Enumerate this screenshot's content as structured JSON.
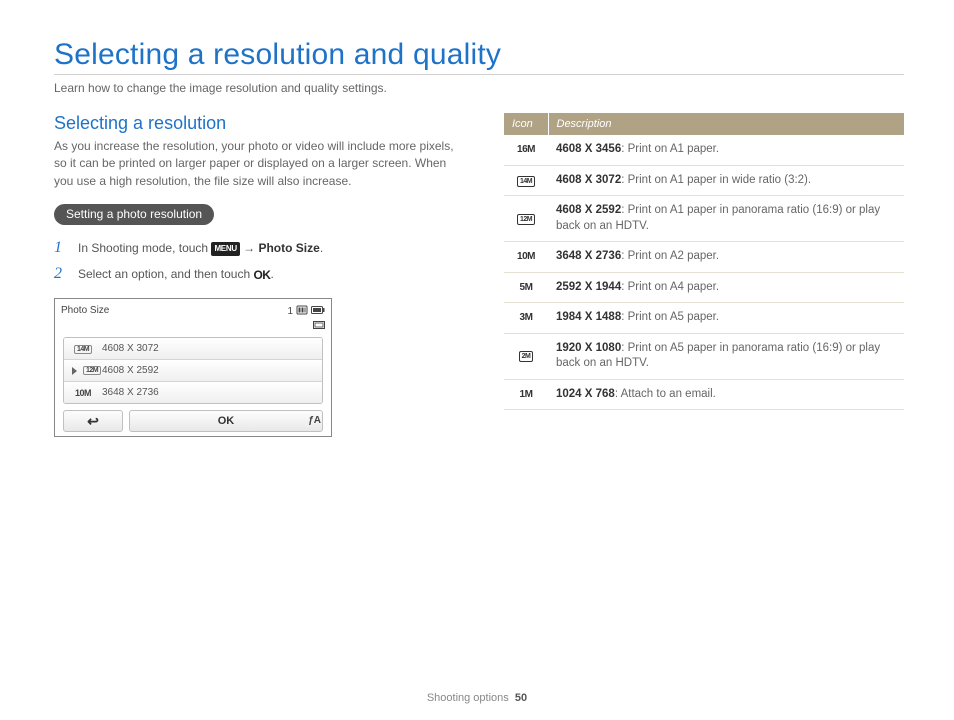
{
  "page": {
    "title": "Selecting a resolution and quality",
    "subtitle": "Learn how to change the image resolution and quality settings."
  },
  "section": {
    "heading": "Selecting a resolution",
    "para": "As you increase the resolution, your photo or video will include more pixels, so it can be printed on larger paper or displayed on a larger screen. When you use a high resolution, the file size will also increase.",
    "pill": "Setting a photo resolution"
  },
  "steps": [
    {
      "num": "1",
      "pre": "In Shooting mode, touch ",
      "menu_chip": "MENU",
      "arrow": " → ",
      "bold": "Photo Size",
      "post": "."
    },
    {
      "num": "2",
      "pre": "Select an option, and then touch ",
      "ok_chip": "OK",
      "post": "."
    }
  ],
  "screen": {
    "title": "Photo Size",
    "status_count": "1",
    "rows": [
      {
        "icon_label": "14M",
        "icon_style": "box",
        "text": "4608 X 3072"
      },
      {
        "icon_label": "12M",
        "icon_style": "box",
        "text": "4608 X 2592",
        "selected": true
      },
      {
        "icon_label": "10M",
        "icon_style": "text",
        "text": "3648 X 2736"
      }
    ],
    "back_glyph": "↩",
    "ok_label": "OK",
    "flash_label": "ƒA"
  },
  "table": {
    "head_icon": "Icon",
    "head_desc": "Description",
    "rows": [
      {
        "icon": "16M",
        "icon_style": "text",
        "res": "4608 X 3456",
        "desc": ": Print on A1 paper."
      },
      {
        "icon": "14M",
        "icon_style": "box",
        "res": "4608 X 3072",
        "desc": ": Print on A1 paper in wide ratio (3:2)."
      },
      {
        "icon": "12M",
        "icon_style": "box",
        "res": "4608 X 2592",
        "desc": ": Print on A1 paper in panorama ratio (16:9) or play back on an HDTV."
      },
      {
        "icon": "10M",
        "icon_style": "text",
        "res": "3648 X 2736",
        "desc": ": Print on A2 paper."
      },
      {
        "icon": "5M",
        "icon_style": "text",
        "res": "2592 X 1944",
        "desc": ": Print on A4 paper."
      },
      {
        "icon": "3M",
        "icon_style": "text",
        "res": "1984 X 1488",
        "desc": ": Print on A5 paper."
      },
      {
        "icon": "2M",
        "icon_style": "box",
        "res": "1920 X 1080",
        "desc": ": Print on A5 paper in panorama ratio (16:9) or play back on an HDTV."
      },
      {
        "icon": "1M",
        "icon_style": "text",
        "res": "1024 X 768",
        "desc": ": Attach to an email."
      }
    ]
  },
  "footer": {
    "section": "Shooting options",
    "page": "50"
  }
}
